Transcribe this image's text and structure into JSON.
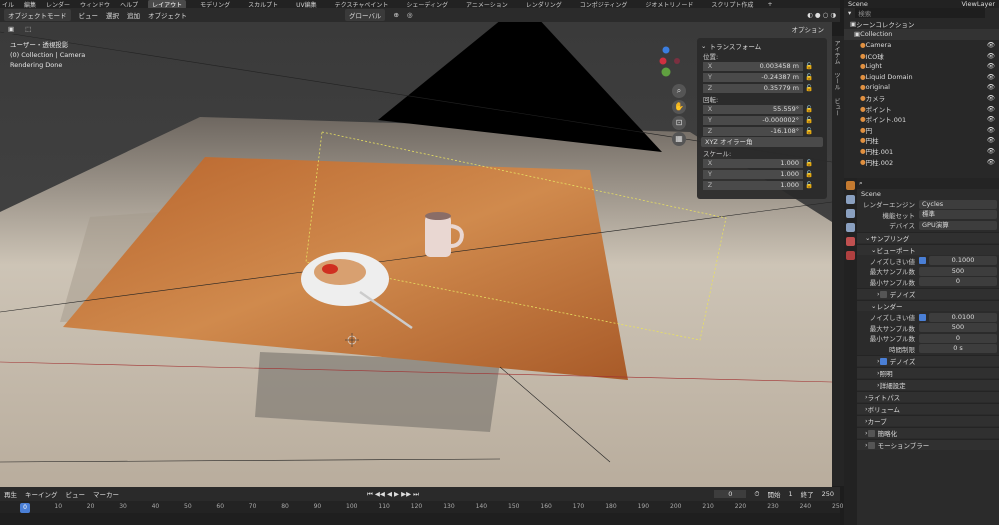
{
  "menu": {
    "items": [
      "イル",
      "編集",
      "レンダー",
      "ウィンドウ",
      "ヘルプ"
    ],
    "workspaces": [
      "レイアウト",
      "モデリング",
      "スカルプト",
      "UV編集",
      "テクスチャペイント",
      "シェーディング",
      "アニメーション",
      "レンダリング",
      "コンポジティング",
      "ジオメトリノード",
      "スクリプト作成"
    ],
    "add_tab": "+",
    "scene": "Scene",
    "view_layer": "ViewLayer"
  },
  "header": {
    "mode": "オブジェクトモード",
    "menus": [
      "ビュー",
      "選択",
      "追加",
      "オブジェクト"
    ],
    "orientation": "グローバル",
    "options": "オプション"
  },
  "viewport": {
    "overlay_lines": [
      "ユーザー・透視投影",
      "(0) Collection | Camera",
      "Rendering Done"
    ]
  },
  "npanel": {
    "title": "トランスフォーム",
    "location_label": "位置:",
    "location": [
      {
        "axis": "X",
        "value": "0.003458 m"
      },
      {
        "axis": "Y",
        "value": "-0.24387 m"
      },
      {
        "axis": "Z",
        "value": "0.35779 m"
      }
    ],
    "rotation_label": "回転:",
    "rotation": [
      {
        "axis": "X",
        "value": "55.559°"
      },
      {
        "axis": "Y",
        "value": "-0.000002°"
      },
      {
        "axis": "Z",
        "value": "-16.108°"
      }
    ],
    "rotation_mode": "XYZ オイラー角",
    "scale_label": "スケール:",
    "scale": [
      {
        "axis": "X",
        "value": "1.000"
      },
      {
        "axis": "Y",
        "value": "1.000"
      },
      {
        "axis": "Z",
        "value": "1.000"
      }
    ],
    "tabs": [
      "アイテム",
      "ツール",
      "ビュー"
    ]
  },
  "timeline": {
    "menus": [
      "再生",
      "キーイング",
      "ビュー",
      "マーカー"
    ],
    "current_frame": "0",
    "start_label": "開始",
    "start": "1",
    "end_label": "終了",
    "end": "250",
    "ruler": [
      "0",
      "10",
      "20",
      "30",
      "40",
      "50",
      "60",
      "70",
      "80",
      "90",
      "100",
      "110",
      "120",
      "130",
      "140",
      "150",
      "160",
      "170",
      "180",
      "190",
      "200",
      "210",
      "220",
      "230",
      "240",
      "250"
    ]
  },
  "outliner": {
    "search_placeholder": "検索",
    "root": "シーンコレクション",
    "collection": "Collection",
    "objects": [
      "Camera",
      "ICO球",
      "Light",
      "Liquid Domain",
      "original",
      "カメラ",
      "ポイント",
      "ポイント.001",
      "円",
      "円柱",
      "円柱.001",
      "円柱.002"
    ]
  },
  "properties": {
    "scene": "Scene",
    "render_engine_label": "レンダーエンジン",
    "render_engine": "Cycles",
    "feature_set_label": "機能セット",
    "feature_set": "標準",
    "device_label": "デバイス",
    "device": "GPU演算",
    "sampling": "サンプリング",
    "viewport": "ビューポート",
    "noise_threshold_label": "ノイズしきい値",
    "viewport_noise": "0.1000",
    "max_samples_label": "最大サンプル数",
    "viewport_max": "500",
    "min_samples_label": "最小サンプル数",
    "viewport_min": "0",
    "denoise": "デノイズ",
    "render": "レンダー",
    "render_noise": "0.0100",
    "render_max": "500",
    "render_min": "0",
    "time_limit_label": "時間制限",
    "time_limit": "0 s",
    "render_denoise": "デノイズ",
    "lighting": "照明",
    "advanced": "詳細設定",
    "light_paths": "ライトパス",
    "volumes": "ボリューム",
    "curves": "カーブ",
    "simplify": "簡略化",
    "motion_blur": "モーションブラー"
  }
}
